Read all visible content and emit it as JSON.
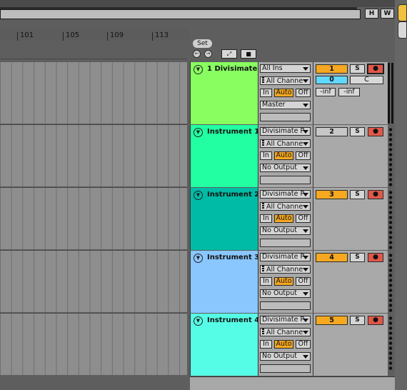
{
  "header": {
    "h_button": "H",
    "w_button": "W",
    "set_button": "Set"
  },
  "ruler": {
    "labels": [
      "101",
      "105",
      "109",
      "113"
    ]
  },
  "colors": {
    "master_track": "#88fe61",
    "instrument_1": "#22fea2",
    "instrument_2": "#00bca6",
    "instrument_3": "#89c7fe",
    "instrument_4": "#56fde6",
    "accent_on": "#f5a820",
    "arm_red": "#e0574a",
    "input_cyan": "#60d8ff"
  },
  "tracks": [
    {
      "name": "1 Divisimate",
      "input_type": "All Ins",
      "input_channel": "All Channe",
      "monitor": {
        "in": "In",
        "auto": "Auto",
        "off": "Off"
      },
      "output": "Master",
      "number": "1",
      "solo": "S",
      "pan_value": "0",
      "pan_label": "C",
      "vol_left": "-inf",
      "vol_right": "-inf"
    },
    {
      "name": "Instrument 1",
      "input_type": "Divisimate P",
      "input_channel": "All Channe",
      "monitor": {
        "in": "In",
        "auto": "Auto",
        "off": "Off"
      },
      "output": "No Output",
      "number": "2",
      "solo": "S"
    },
    {
      "name": "Instrument 2",
      "input_type": "Divisimate P",
      "input_channel": "All Channe",
      "monitor": {
        "in": "In",
        "auto": "Auto",
        "off": "Off"
      },
      "output": "No Output",
      "number": "3",
      "solo": "S"
    },
    {
      "name": "Instrument 3",
      "input_type": "Divisimate P",
      "input_channel": "All Channe",
      "monitor": {
        "in": "In",
        "auto": "Auto",
        "off": "Off"
      },
      "output": "No Output",
      "number": "4",
      "solo": "S"
    },
    {
      "name": "Instrument 4",
      "input_type": "Divisimate P",
      "input_channel": "All Channe",
      "monitor": {
        "in": "In",
        "auto": "Auto",
        "off": "Off"
      },
      "output": "No Output",
      "number": "5",
      "solo": "S"
    }
  ],
  "icons": {
    "fold": "fold-triangle-icon",
    "arm": "record-arm-icon",
    "back": "back-arrow-icon",
    "forward": "forward-arrow-icon",
    "expand": "expand-icon",
    "lock": "lock-icon"
  }
}
